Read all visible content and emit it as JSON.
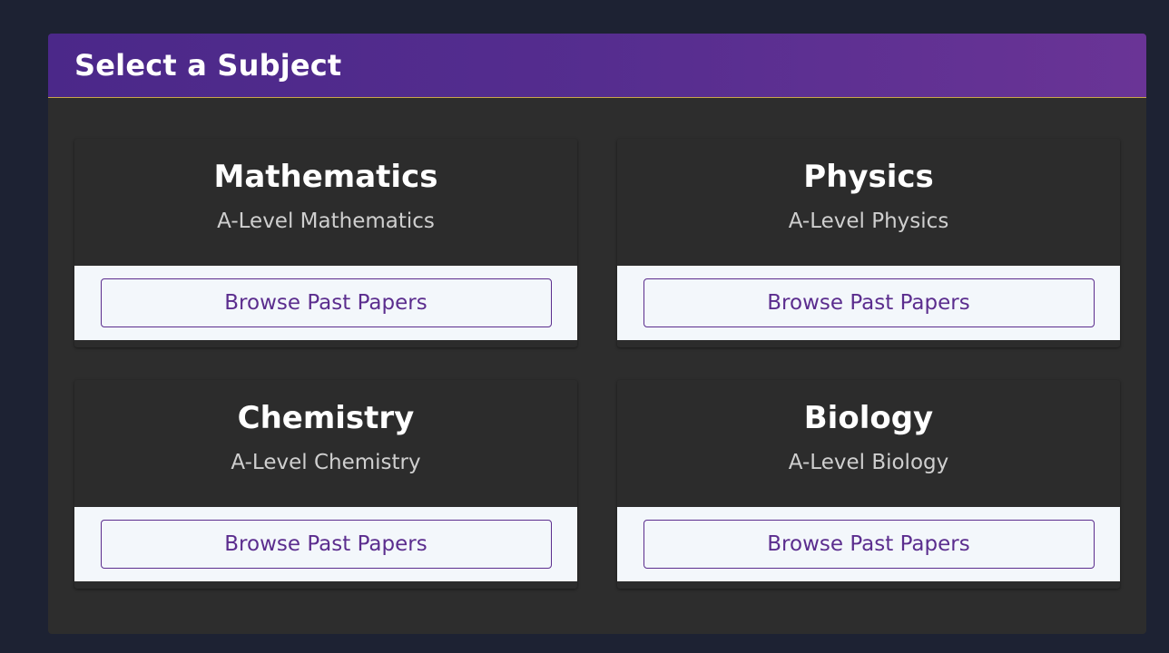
{
  "header": {
    "title": "Select a Subject"
  },
  "subjects": [
    {
      "title": "Mathematics",
      "subtitle": "A-Level Mathematics",
      "button_label": "Browse Past Papers"
    },
    {
      "title": "Physics",
      "subtitle": "A-Level Physics",
      "button_label": "Browse Past Papers"
    },
    {
      "title": "Chemistry",
      "subtitle": "A-Level Chemistry",
      "button_label": "Browse Past Papers"
    },
    {
      "title": "Biology",
      "subtitle": "A-Level Biology",
      "button_label": "Browse Past Papers"
    }
  ],
  "colors": {
    "page_background": "#1d2233",
    "panel_background": "#2d2d2d",
    "header_gradient_start": "#4b2889",
    "header_gradient_end": "#6a3496",
    "accent": "#5b2d8e",
    "card_footer_background": "#f3f7fb"
  }
}
